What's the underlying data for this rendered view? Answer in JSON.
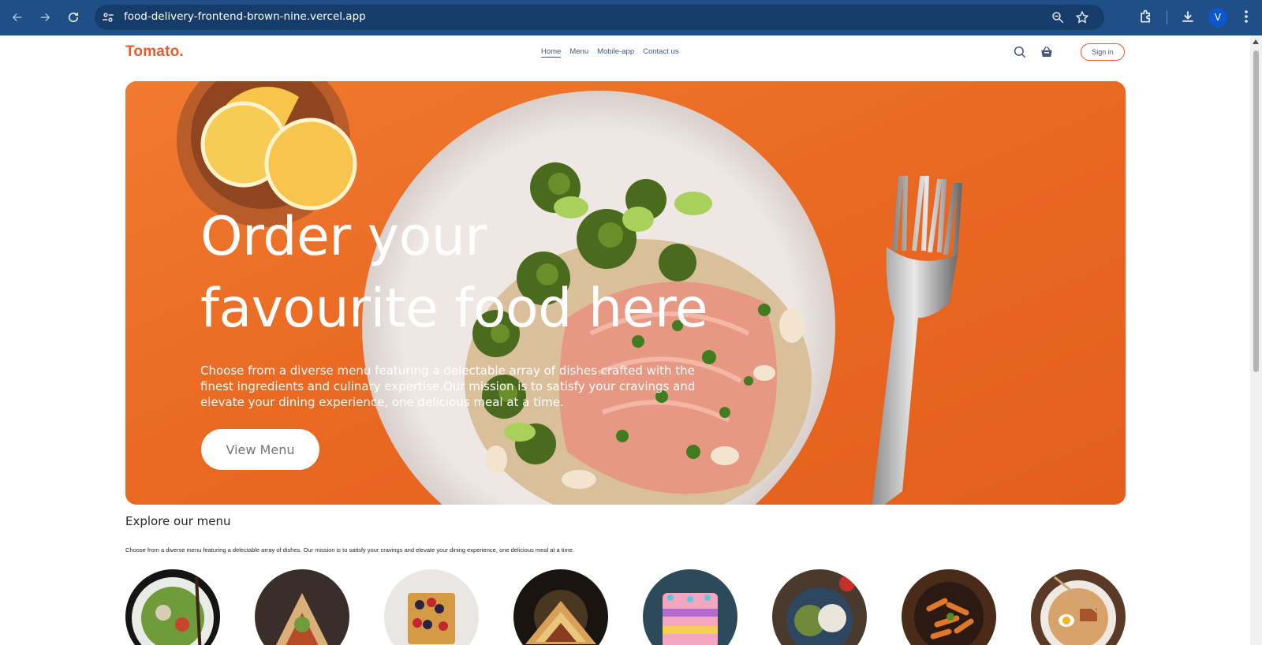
{
  "browser": {
    "url": "food-delivery-frontend-brown-nine.vercel.app",
    "profile_initial": "V",
    "icons": [
      "back-arrow-icon",
      "forward-arrow-icon",
      "reload-icon",
      "site-settings-icon",
      "zoom-icon",
      "bookmark-star-icon",
      "extensions-icon",
      "download-icon",
      "menu-kebab-icon"
    ]
  },
  "navbar": {
    "logo": "Tomato.",
    "items": [
      {
        "label": "Home",
        "active": true
      },
      {
        "label": "Menu",
        "active": false
      },
      {
        "label": "Mobile-app",
        "active": false
      },
      {
        "label": "Contact us",
        "active": false
      }
    ],
    "signin_label": "Sign in"
  },
  "hero": {
    "title_line1": "Order your",
    "title_line2": "favourite food here",
    "description": "Choose from a diverse menu featuring a delectable array of dishes crafted with the finest ingredients and culinary expertise.Our mission is to satisfy your cravings and elevate your dining experience, one delicious meal at a time.",
    "button_label": "View Menu"
  },
  "explore": {
    "title": "Explore our menu",
    "description": "Choose from a diverse menu featuring a delectable array of dishes. Our mission is to satisfy your cravings and elevate your dining experience, one delicious meal at a time.",
    "dishes": [
      "salad-image",
      "rolls-image",
      "desserts-image",
      "sandwich-image",
      "cake-image",
      "pure-veg-image",
      "pasta-image",
      "noodles-image"
    ]
  },
  "colors": {
    "brand": "#e65c2a",
    "hero_bg": "#eb6b24",
    "nav_text": "#49557e",
    "chrome_bg": "#1f4f86"
  }
}
